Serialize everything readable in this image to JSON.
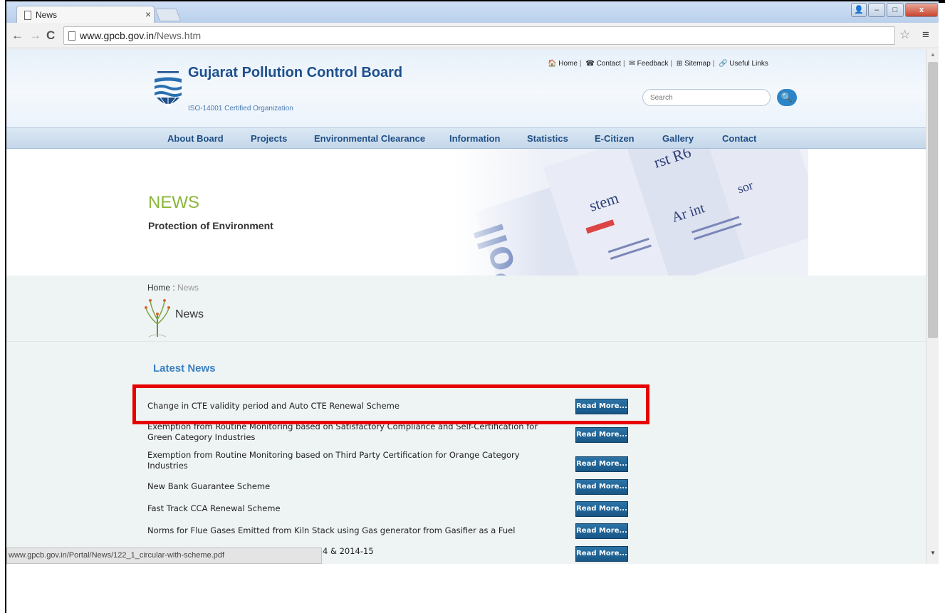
{
  "browser": {
    "tab_title": "News",
    "tab_close": "×",
    "url_host": "www.gpcb.gov.in",
    "url_path": "/News.htm",
    "back": "←",
    "forward": "→",
    "reload": "C",
    "star": "☆",
    "menu": "≡",
    "status_url": "www.gpcb.gov.in/Portal/News/122_1_circular-with-scheme.pdf"
  },
  "window_controls": {
    "user": "👤",
    "minimize": "–",
    "maximize": "□",
    "close": "x"
  },
  "header": {
    "title": "Gujarat Pollution Control Board",
    "subtitle": "ISO-14001 Certified Organization",
    "toplinks": [
      "Home",
      "Contact",
      "Feedback",
      "Sitemap",
      "Useful Links"
    ],
    "search_placeholder": "Search",
    "search_icon": "magnifier-icon"
  },
  "nav": [
    "About Board",
    "Projects",
    "Environmental Clearance",
    "Information",
    "Statistics",
    "E-Citizen",
    "Gallery",
    "Contact"
  ],
  "banner": {
    "title": "NEWS",
    "subtitle": "Protection of Environment"
  },
  "breadcrumb": {
    "home": "Home",
    "sep": " : ",
    "current": "News"
  },
  "page_heading": "News",
  "latest_heading": "Latest News",
  "read_more_label": "Read More...",
  "news": [
    "Change in CTE validity period and Auto CTE Renewal Scheme",
    "Exemption from Routine Monitoring based on Satisfactory Compliance and Self-Certification for Green Category Industries",
    "Exemption from Routine Monitoring based on Third Party Certification for Orange Category Industries",
    "New Bank Guarantee Scheme",
    "Fast Track CCA Renewal Scheme",
    "Norms for Flue Gases Emitted from Kiln Stack using Gas generator from Gasifier as a Fuel",
    "4 & 2014-15"
  ],
  "highlight_color": "#e60000"
}
